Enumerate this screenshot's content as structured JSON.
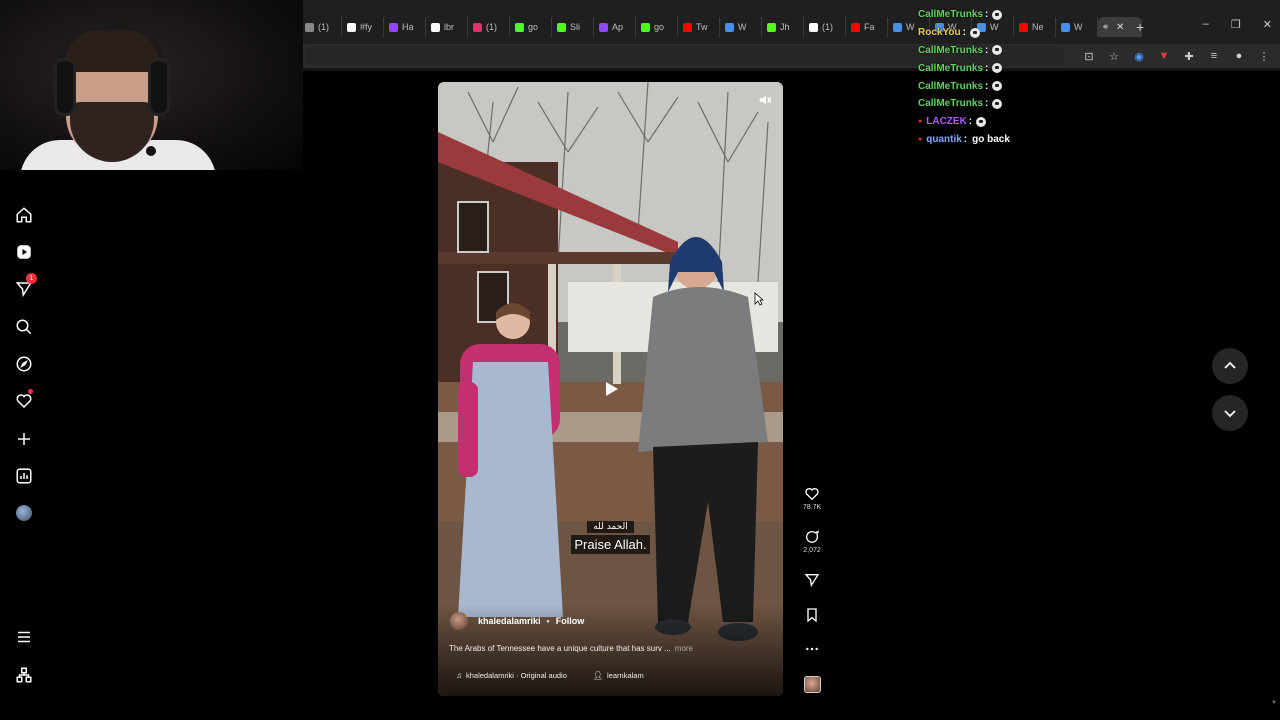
{
  "browser": {
    "tabs": [
      {
        "label": "(1)",
        "color": "#888888"
      },
      {
        "label": "#fy",
        "color": "#ffffff"
      },
      {
        "label": "Ha",
        "color": "#9146ff"
      },
      {
        "label": "lbr",
        "color": "#ffffff"
      },
      {
        "label": "(1)",
        "color": "#e1306c"
      },
      {
        "label": "go",
        "color": "#53fc18"
      },
      {
        "label": "Sli",
        "color": "#53fc18"
      },
      {
        "label": "Ap",
        "color": "#9146ff"
      },
      {
        "label": "go",
        "color": "#53fc18"
      },
      {
        "label": "Tw",
        "color": "#ff0000"
      },
      {
        "label": "W",
        "color": "#4a90e2"
      },
      {
        "label": "Jh",
        "color": "#53fc18"
      },
      {
        "label": "(1)",
        "color": "#ffffff"
      },
      {
        "label": "Fa",
        "color": "#ff0000"
      },
      {
        "label": "W",
        "color": "#4a90e2"
      },
      {
        "label": "W",
        "color": "#4a90e2"
      },
      {
        "label": "W",
        "color": "#4a90e2"
      },
      {
        "label": "Ne",
        "color": "#ff0000"
      },
      {
        "label": "W",
        "color": "#4a90e2"
      }
    ],
    "active_tab_close": "✕",
    "new_tab": "+",
    "window_controls": [
      "–",
      "❐",
      "✕"
    ]
  },
  "chat": [
    {
      "user": "CallMeTrunks",
      "color": "#5fd35f",
      "msg": ""
    },
    {
      "user": "RockYou",
      "color": "#e6d04a",
      "msg": ""
    },
    {
      "user": "CallMeTrunks",
      "color": "#5fd35f",
      "msg": ""
    },
    {
      "user": "CallMeTrunks",
      "color": "#5fd35f",
      "msg": ""
    },
    {
      "user": "CallMeTrunks",
      "color": "#5fd35f",
      "msg": ""
    },
    {
      "user": "CallMeTrunks",
      "color": "#5fd35f",
      "msg": ""
    },
    {
      "user": "LACZEK",
      "color": "#b05cff",
      "msg": ""
    },
    {
      "user": "quantik",
      "color": "#7fa7ff",
      "msg": "go back"
    }
  ],
  "nav_badge": "1",
  "video": {
    "caption_arabic": "الحمد لله",
    "caption_english": "Praise Allah.",
    "author": "khaledalamriki",
    "follow": "Follow",
    "description": "The Arabs of Tennessee have a unique culture that has surv ...",
    "more": "more",
    "audio": "khaledalamriki · Original audio",
    "tagged": "learnkalam"
  },
  "actions": {
    "likes": "78.7K",
    "comments": "2,072"
  },
  "colors": {
    "accent_red": "#ff3040",
    "background": "#000000"
  }
}
